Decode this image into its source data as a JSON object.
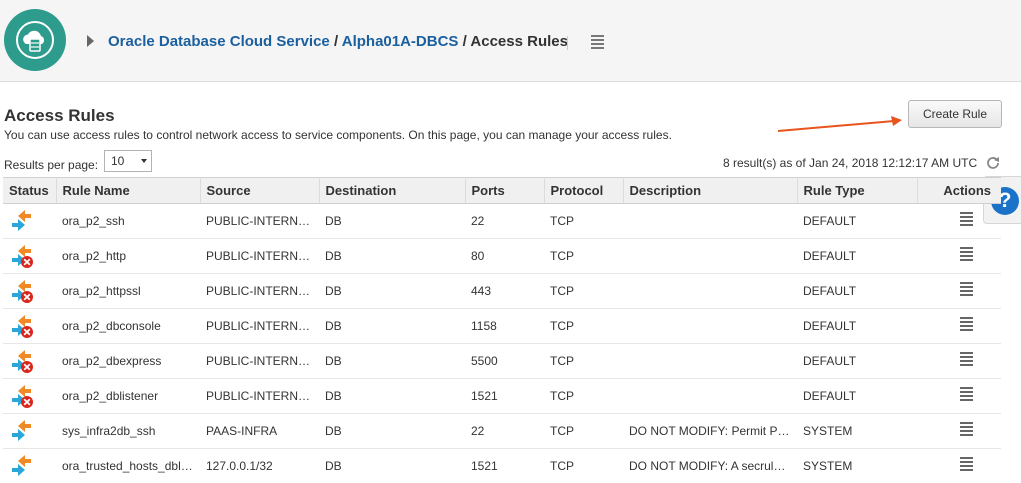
{
  "header": {
    "breadcrumb": [
      {
        "label": "Oracle Database Cloud Service"
      },
      {
        "label": "Alpha01A-DBCS"
      }
    ],
    "current": "Access Rules",
    "separator": "/"
  },
  "section": {
    "title": "Access Rules",
    "description": "You can use access rules to control network access to service components. On this page, you can manage your access rules.",
    "create_button": "Create Rule"
  },
  "pagination": {
    "results_per_page_label": "Results per page:",
    "results_per_page_value": "10",
    "result_summary": "8 result(s) as of Jan 24, 2018 12:12:17 AM UTC"
  },
  "help": {
    "label": "?"
  },
  "table": {
    "columns": [
      "Status",
      "Rule Name",
      "Source",
      "Destination",
      "Ports",
      "Protocol",
      "Description",
      "Rule Type",
      "Actions"
    ],
    "rows": [
      {
        "status": "enabled",
        "name": "ora_p2_ssh",
        "source": "PUBLIC-INTERNET",
        "destination": "DB",
        "ports": "22",
        "protocol": "TCP",
        "description": "",
        "type": "DEFAULT"
      },
      {
        "status": "disabled",
        "name": "ora_p2_http",
        "source": "PUBLIC-INTERNET",
        "destination": "DB",
        "ports": "80",
        "protocol": "TCP",
        "description": "",
        "type": "DEFAULT"
      },
      {
        "status": "disabled",
        "name": "ora_p2_httpssl",
        "source": "PUBLIC-INTERNET",
        "destination": "DB",
        "ports": "443",
        "protocol": "TCP",
        "description": "",
        "type": "DEFAULT"
      },
      {
        "status": "disabled",
        "name": "ora_p2_dbconsole",
        "source": "PUBLIC-INTERNET",
        "destination": "DB",
        "ports": "1158",
        "protocol": "TCP",
        "description": "",
        "type": "DEFAULT"
      },
      {
        "status": "disabled",
        "name": "ora_p2_dbexpress",
        "source": "PUBLIC-INTERNET",
        "destination": "DB",
        "ports": "5500",
        "protocol": "TCP",
        "description": "",
        "type": "DEFAULT"
      },
      {
        "status": "disabled",
        "name": "ora_p2_dblistener",
        "source": "PUBLIC-INTERNET",
        "destination": "DB",
        "ports": "1521",
        "protocol": "TCP",
        "description": "",
        "type": "DEFAULT"
      },
      {
        "status": "enabled",
        "name": "sys_infra2db_ssh",
        "source": "PAAS-INFRA",
        "destination": "DB",
        "ports": "22",
        "protocol": "TCP",
        "description": "DO NOT MODIFY: Permit P…",
        "type": "SYSTEM"
      },
      {
        "status": "enabled",
        "name": "ora_trusted_hosts_dbl…",
        "source": "127.0.0.1/32",
        "destination": "DB",
        "ports": "1521",
        "protocol": "TCP",
        "description": "DO NOT MODIFY: A secrule…",
        "type": "SYSTEM"
      }
    ]
  },
  "colors": {
    "link": "#1a5f9e",
    "logo": "#2e9c8c",
    "help": "#1a73c9",
    "annotation_arrow": "#e8541c",
    "status_orange": "#f08a24",
    "status_blue": "#2aa6d8",
    "status_red": "#d9261c"
  },
  "icons": {
    "logo": "cloud-database-icon",
    "menu": "hamburger-menu-icon",
    "refresh": "refresh-icon",
    "status_enabled": "bidirectional-arrows-icon",
    "status_disabled": "bidirectional-arrows-disabled-icon"
  }
}
